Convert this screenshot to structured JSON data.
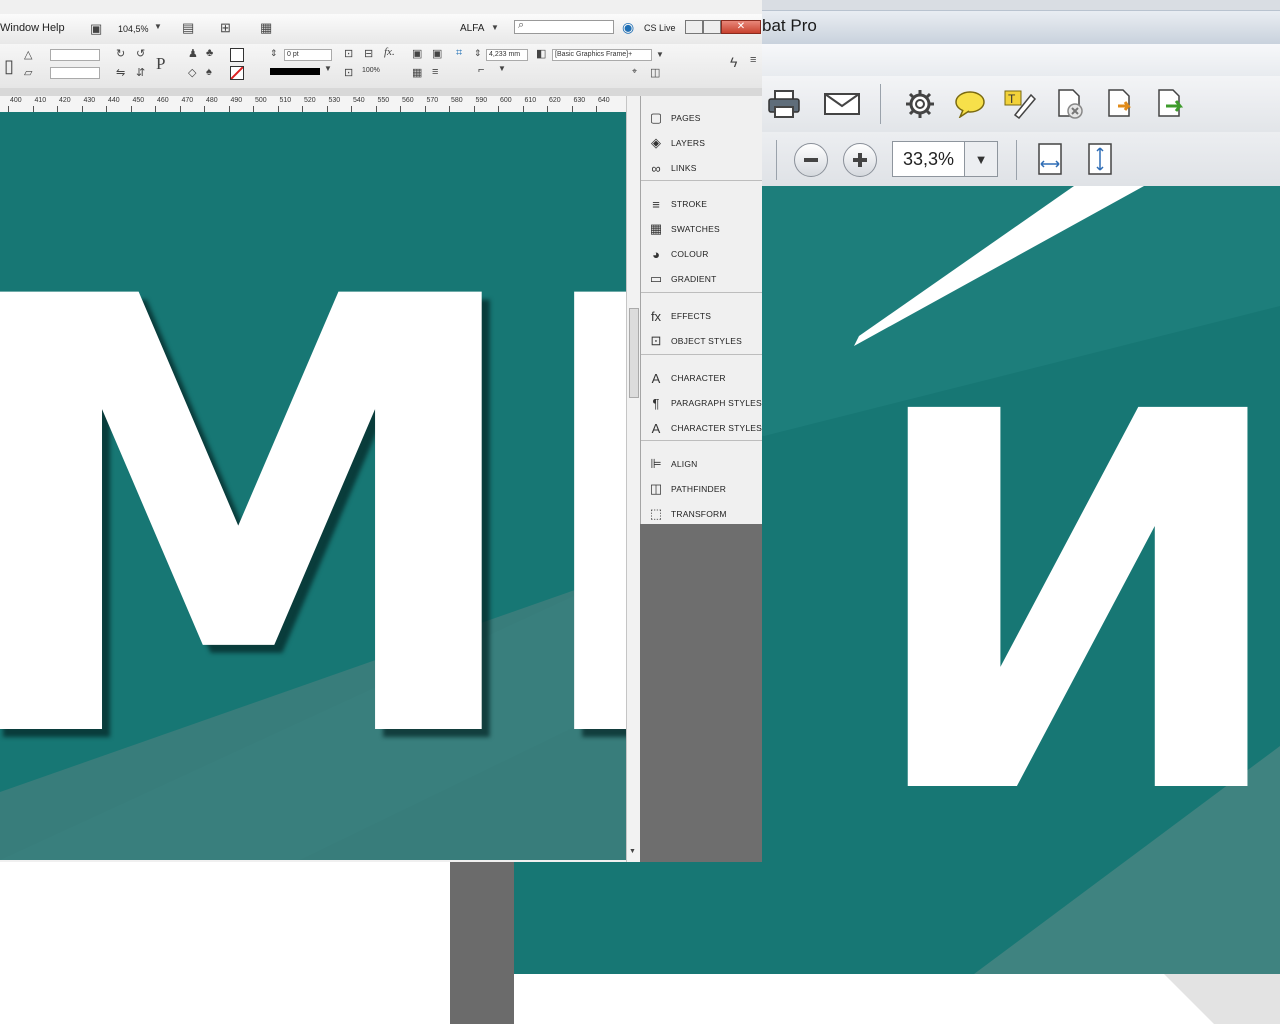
{
  "indesign": {
    "menu": {
      "window": "Window",
      "help": "Help",
      "zoom": "104,5%",
      "workspace": "ALFA",
      "cs_live": "CS Live"
    },
    "control": {
      "stroke_weight": "0 pt",
      "scale": "100%",
      "offset": "4,233 mm",
      "object_style": "[Basic Graphics Frame]+"
    },
    "ruler_labels": [
      "400",
      "410",
      "420",
      "430",
      "440",
      "450",
      "460",
      "470",
      "480",
      "490",
      "500",
      "510",
      "520",
      "530",
      "540",
      "550",
      "560",
      "570",
      "580",
      "590",
      "600",
      "610",
      "620",
      "630",
      "640"
    ],
    "canvas_text": "МНР",
    "panels": {
      "group1": [
        {
          "icon": "pages-icon",
          "glyph": "▢",
          "label": "PAGES"
        },
        {
          "icon": "layers-icon",
          "glyph": "◈",
          "label": "LAYERS"
        },
        {
          "icon": "links-icon",
          "glyph": "∞",
          "label": "LINKS"
        }
      ],
      "group2": [
        {
          "icon": "stroke-icon",
          "glyph": "≡",
          "label": "STROKE"
        },
        {
          "icon": "swatches-icon",
          "glyph": "▦",
          "label": "SWATCHES"
        },
        {
          "icon": "colour-icon",
          "glyph": "◕",
          "label": "COLOUR"
        },
        {
          "icon": "gradient-icon",
          "glyph": "▭",
          "label": "GRADIENT"
        }
      ],
      "group3": [
        {
          "icon": "effects-icon",
          "glyph": "fx",
          "label": "EFFECTS"
        },
        {
          "icon": "object-styles-icon",
          "glyph": "⊡",
          "label": "OBJECT STYLES"
        }
      ],
      "group4": [
        {
          "icon": "character-icon",
          "glyph": "A",
          "label": "CHARACTER"
        },
        {
          "icon": "paragraph-styles-icon",
          "glyph": "¶",
          "label": "PARAGRAPH STYLES"
        },
        {
          "icon": "character-styles-icon",
          "glyph": "A",
          "label": "CHARACTER STYLES"
        }
      ],
      "group5": [
        {
          "icon": "align-icon",
          "glyph": "⊫",
          "label": "ALIGN"
        },
        {
          "icon": "pathfinder-icon",
          "glyph": "◫",
          "label": "PATHFINDER"
        },
        {
          "icon": "transform-icon",
          "glyph": "⬚",
          "label": "TRANSFORM"
        }
      ]
    }
  },
  "acrobat": {
    "title": "bat Pro",
    "zoom": "33,3%",
    "canvas_text": "ИГ",
    "toolbar_icons": [
      "print-icon",
      "email-icon",
      "settings-icon",
      "comment-icon",
      "highlight-icon",
      "delete-page-icon",
      "export-icon",
      "export-green-icon"
    ]
  },
  "colors": {
    "teal": "#177774",
    "teal_light": "#3a7f7c",
    "panel_gray": "#6e6e6e"
  }
}
